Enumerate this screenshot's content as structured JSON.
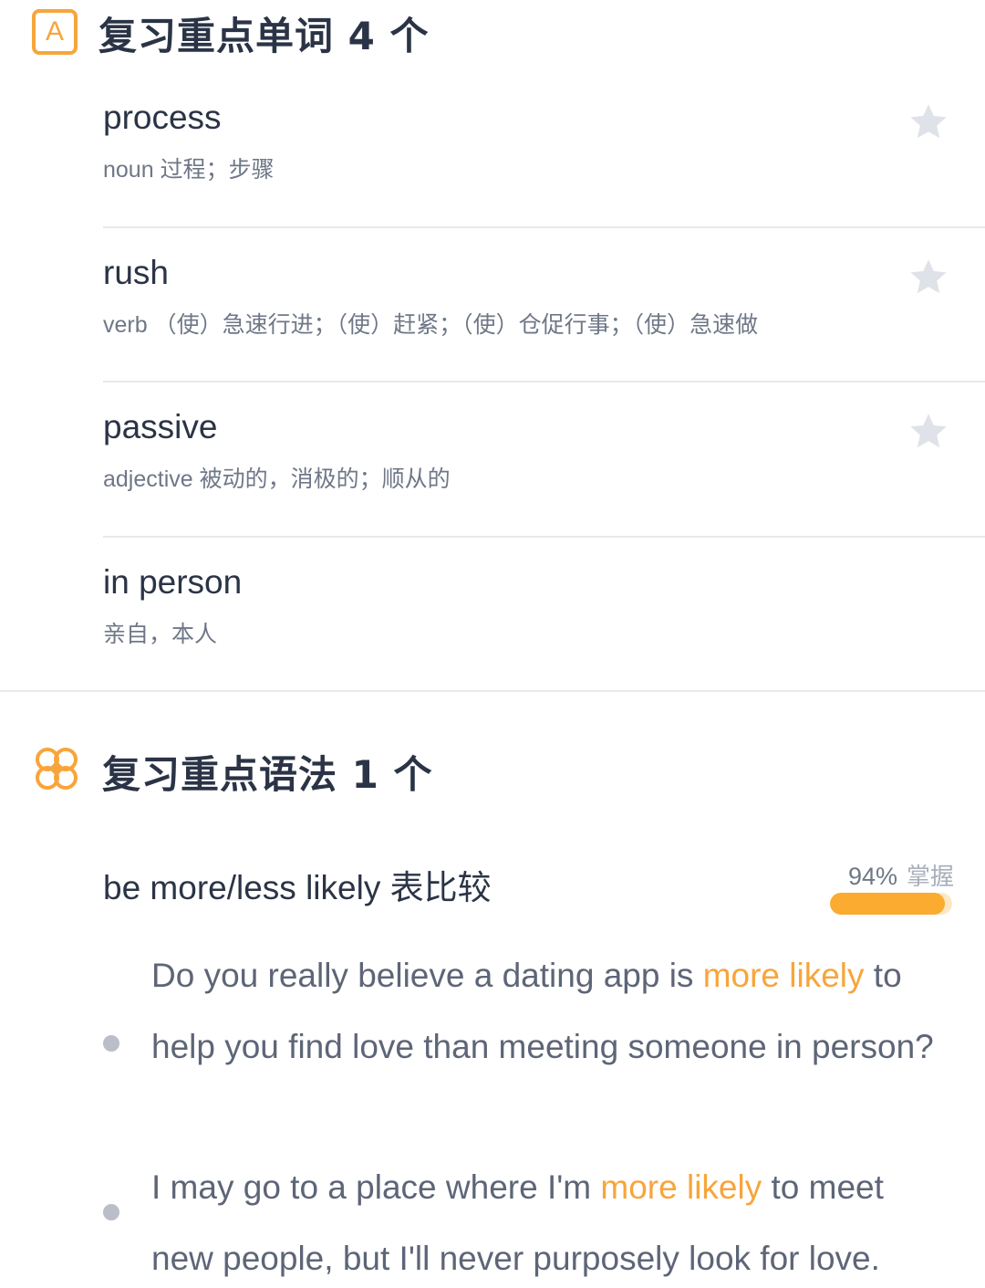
{
  "vocab_section": {
    "icon_letter": "A",
    "title": "复习重点单词 4 个",
    "words": [
      {
        "word": "process",
        "definition": "noun 过程；步骤",
        "starred": false
      },
      {
        "word": "rush",
        "definition": "verb （使）急速行进；（使）赶紧；（使）仓促行事；（使）急速做",
        "starred": false
      },
      {
        "word": "passive",
        "definition": "adjective 被动的，消极的；顺从的",
        "starred": false
      },
      {
        "word": "in person",
        "definition": "亲自，本人"
      }
    ]
  },
  "grammar_section": {
    "title": "复习重点语法 1 个",
    "point": "be more/less likely 表比较",
    "mastery": {
      "percent_label": "94%",
      "word": "掌握",
      "fraction": 0.94
    },
    "examples": [
      {
        "before": "Do you really believe a dating app is ",
        "highlight": "more likely",
        "after": " to help you find love than meeting someone in person?"
      },
      {
        "before": "I may go to a place where I'm ",
        "highlight": "more likely",
        "after": " to meet new people, but I'll never purposely look for love."
      }
    ]
  },
  "colors": {
    "accent": "#f7a53b",
    "text_primary": "#2b3446",
    "text_secondary": "#6f7787",
    "star_inactive": "#dfe2e8",
    "divider": "#e7e9ee"
  },
  "icons": {
    "vocab": "letter-a-square-icon",
    "grammar": "grammar-knot-icon",
    "star": "star-icon"
  }
}
